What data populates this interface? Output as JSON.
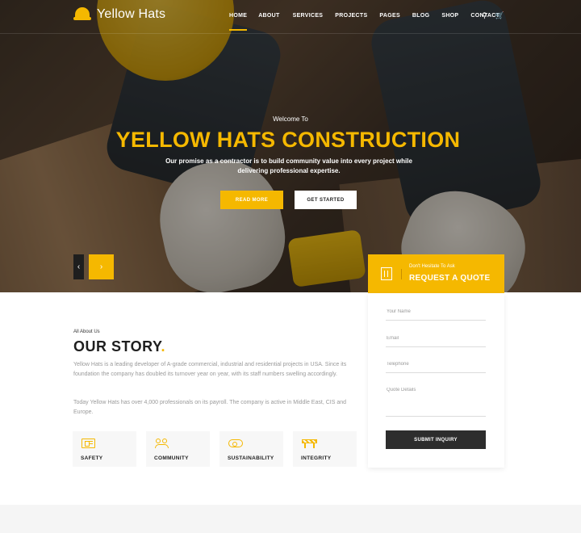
{
  "brand": {
    "name": "Yellow Hats",
    "accent": "#f5b800",
    "dark": "#2d2d2d"
  },
  "nav": {
    "items": [
      {
        "label": "HOME",
        "active": true
      },
      {
        "label": "ABOUT",
        "active": false
      },
      {
        "label": "SERVICES",
        "active": false
      },
      {
        "label": "PROJECTS",
        "active": false
      },
      {
        "label": "PAGES",
        "active": false
      },
      {
        "label": "BLOG",
        "active": false
      },
      {
        "label": "SHOP",
        "active": false
      },
      {
        "label": "CONTACT",
        "active": false
      }
    ],
    "icons": [
      "search-icon",
      "cart-icon"
    ]
  },
  "hero": {
    "welcome": "Welcome To",
    "title": "YELLOW HATS CONSTRUCTION",
    "subtitle": "Our promise as a contractor is to build community value into every project while delivering professional expertise.",
    "primary_button": "READ MORE",
    "secondary_button": "GET STARTED",
    "prev_arrow": "‹",
    "next_arrow": "›"
  },
  "quote": {
    "small": "Don't Hesitate To Ask",
    "title": "REQUEST A QUOTE",
    "fields": {
      "name": "Your Name",
      "email": "Email",
      "phone": "Telephone",
      "details": "Quote Details"
    },
    "submit": "SUBMIT INQUIRY"
  },
  "story": {
    "small": "All About Us",
    "title": "OUR STORY",
    "title_dot": ".",
    "para1": "Yellow Hats is a leading developer of A-grade commercial, industrial and residential projects in USA. Since its foundation the company has doubled its turnover year on year, with its staff numbers swelling accordingly.",
    "para2": "Today Yellow Hats has over 4,000 professionals on its payroll. The company is active in Middle East, CIS and Europe."
  },
  "features": [
    {
      "label": "SAFETY",
      "icon": "safety-icon"
    },
    {
      "label": "COMMUNITY",
      "icon": "community-icon"
    },
    {
      "label": "SUSTAINABILITY",
      "icon": "sustainability-icon"
    },
    {
      "label": "INTEGRITY",
      "icon": "integrity-icon"
    }
  ]
}
